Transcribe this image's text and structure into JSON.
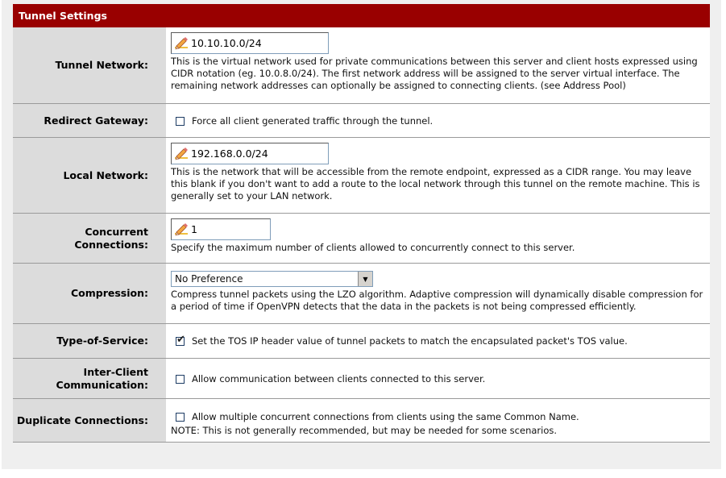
{
  "header": {
    "title": "Tunnel Settings"
  },
  "rows": {
    "tunnel_network": {
      "label": "Tunnel Network:",
      "value": "10.10.10.0/24",
      "description": "This is the virtual network used for private communications between this server and client hosts expressed using CIDR notation (eg. 10.0.8.0/24). The first network address will be assigned to the server virtual interface. The remaining network addresses can optionally be assigned to connecting clients. (see Address Pool)"
    },
    "redirect_gateway": {
      "label": "Redirect Gateway:",
      "checked": false,
      "text": "Force all client generated traffic through the tunnel."
    },
    "local_network": {
      "label": "Local Network:",
      "value": "192.168.0.0/24",
      "description": "This is the network that will be accessible from the remote endpoint, expressed as a CIDR range. You may leave this blank if you don't want to add a route to the local network through this tunnel on the remote machine. This is generally set to your LAN network."
    },
    "concurrent_connections": {
      "label_line1": "Concurrent",
      "label_line2": "Connections:",
      "value": "1",
      "description": "Specify the maximum number of clients allowed to concurrently connect to this server."
    },
    "compression": {
      "label": "Compression:",
      "selected": "No Preference",
      "description": "Compress tunnel packets using the LZO algorithm. Adaptive compression will dynamically disable compression for a period of time if OpenVPN detects that the data in the packets is not being compressed efficiently."
    },
    "type_of_service": {
      "label": "Type-of-Service:",
      "checked": true,
      "text": "Set the TOS IP header value of tunnel packets to match the encapsulated packet's TOS value."
    },
    "inter_client": {
      "label_line1": "Inter-Client",
      "label_line2": "Communication:",
      "checked": false,
      "text": "Allow communication between clients connected to this server."
    },
    "duplicate_connections": {
      "label": "Duplicate Connections:",
      "checked": false,
      "text": "Allow multiple concurrent connections from clients using the same Common Name.",
      "note": "NOTE: This is not generally recommended, but may be needed for some scenarios."
    }
  },
  "colors": {
    "header_bg": "#990000",
    "label_bg": "#dcdcdc"
  },
  "icons": {
    "input_prefix": "pencil-icon",
    "select_arrow": "dropdown-arrow-icon",
    "checkmark": "checkmark-icon"
  }
}
